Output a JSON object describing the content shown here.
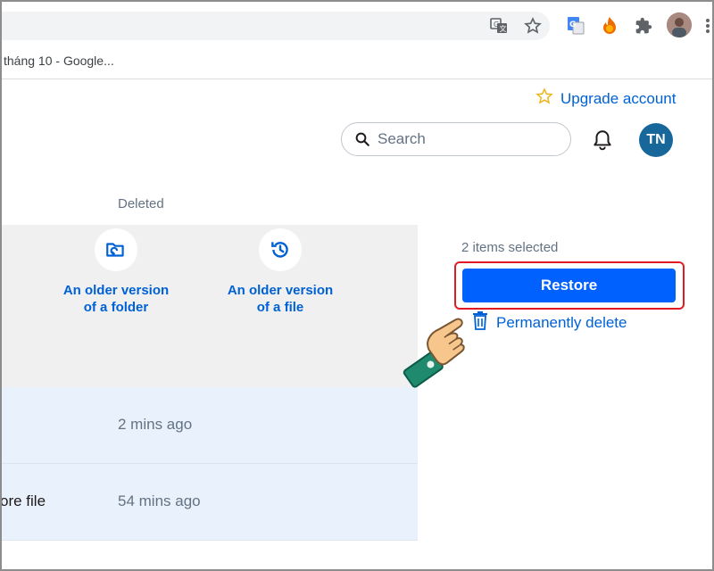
{
  "browser": {
    "bookmark_title": "tháng 10 - Google...",
    "icons": [
      "translate-icon",
      "star-icon",
      "google-translate-ext-icon",
      "fire-ext-icon",
      "puzzle-extensions-icon",
      "profile-avatar",
      "kebab-menu-icon"
    ]
  },
  "header": {
    "upgrade_label": "Upgrade account",
    "search_placeholder": "Search",
    "avatar_initials": "TN"
  },
  "list": {
    "column_deleted": "Deleted",
    "options": [
      {
        "line1": "An older version",
        "line2": "of a folder"
      },
      {
        "line1": "An older version",
        "line2": "of a file"
      }
    ],
    "rows": [
      {
        "name": "",
        "deleted": "2 mins ago"
      },
      {
        "name": "ore file",
        "deleted": "54 mins ago"
      }
    ]
  },
  "sidebar": {
    "selected_count": "2 items selected",
    "restore_label": "Restore",
    "delete_label": "Permanently delete"
  },
  "colors": {
    "accent": "#0061fe",
    "link": "#0061d5",
    "highlight": "#e01b24",
    "avatar_bg": "#17679a"
  }
}
